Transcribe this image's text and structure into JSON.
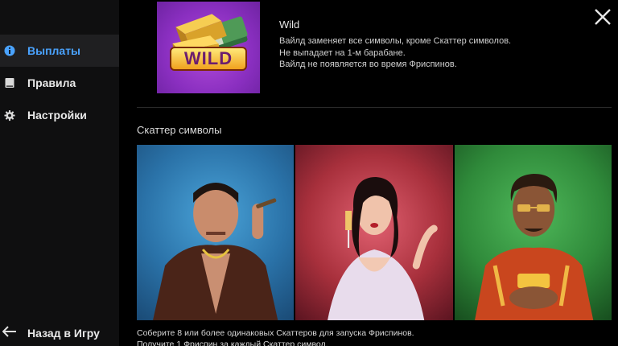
{
  "sidebar": {
    "items": [
      {
        "label": "Выплаты",
        "icon": "info-icon",
        "active": true
      },
      {
        "label": "Правила",
        "icon": "book-icon",
        "active": false
      },
      {
        "label": "Настройки",
        "icon": "gear-icon",
        "active": false
      }
    ],
    "back_label": "Назад в Игру"
  },
  "wild": {
    "title": "Wild",
    "badge_text": "WILD",
    "lines": [
      "Вайлд заменяет все символы, кроме Скаттер символов.",
      "Не выпадает на 1-м барабане.",
      "Вайлд не появляется во время Фриспинов."
    ]
  },
  "scatter": {
    "heading": "Скаттер символы",
    "tiles": [
      {
        "name": "mobster",
        "bg": "#2a72a8"
      },
      {
        "name": "lady",
        "bg": "#a8303c"
      },
      {
        "name": "boss",
        "bg": "#2f8a3a"
      }
    ],
    "lines": [
      "Соберите 8 или более одинаковых Скаттеров для запуска Фриспинов.",
      "Получите 1 Фриспин за каждый Скаттер символ."
    ]
  },
  "colors": {
    "accent": "#4aa3ff",
    "sidebar_bg": "#0f0f10",
    "active_bg": "#1f1f21"
  }
}
